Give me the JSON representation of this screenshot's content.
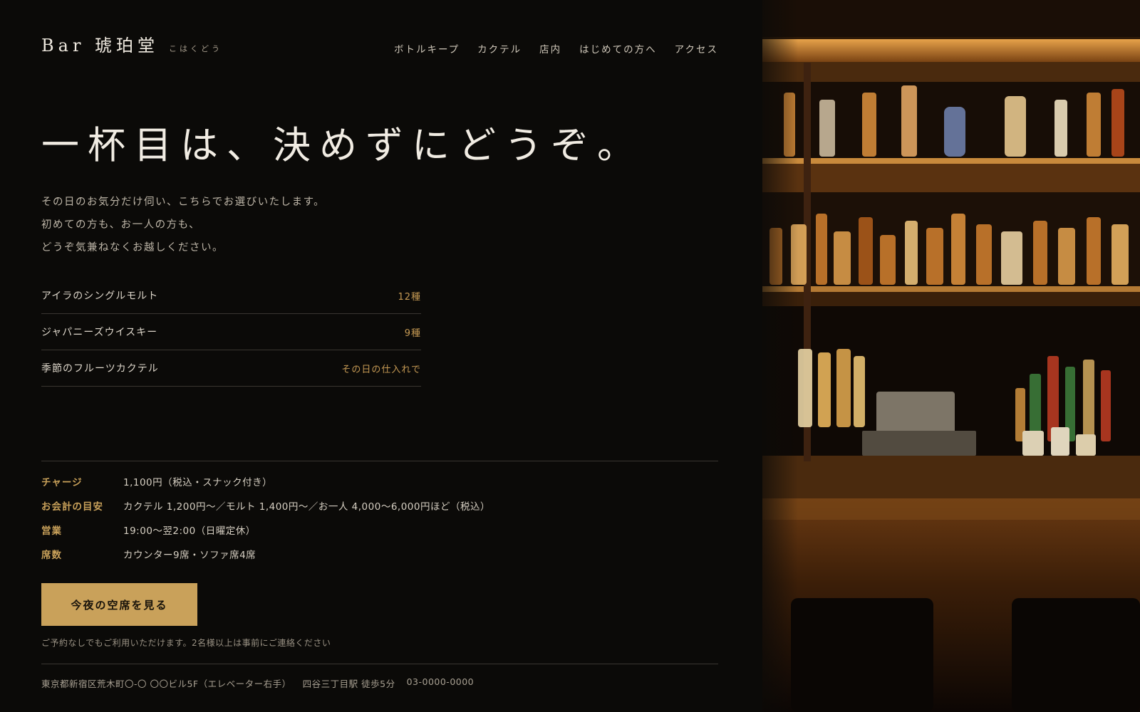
{
  "header": {
    "brand_name": "Bar 琥珀堂",
    "brand_kana": "こはくどう",
    "nav": [
      {
        "label": "ボトルキープ"
      },
      {
        "label": "カクテル"
      },
      {
        "label": "店内"
      },
      {
        "label": "はじめての方へ"
      },
      {
        "label": "アクセス"
      }
    ]
  },
  "hero": {
    "title": "一杯目は、決めずにどうぞ。",
    "lines": [
      "その日のお気分だけ伺い、こちらでお選びいたします。",
      "初めての方も、お一人の方も、",
      "どうぞ気兼ねなくお越しください。"
    ]
  },
  "features": [
    {
      "label": "アイラのシングルモルト",
      "value": "12種"
    },
    {
      "label": "ジャパニーズウイスキー",
      "value": "9種"
    },
    {
      "label": "季節のフルーツカクテル",
      "value": "その日の仕入れで"
    }
  ],
  "info": [
    {
      "key": "チャージ",
      "value": "1,100円（税込・スナック付き）"
    },
    {
      "key": "お会計の目安",
      "value": "カクテル 1,200円〜／モルト 1,400円〜／お一人 4,000〜6,000円ほど（税込）"
    },
    {
      "key": "営業",
      "value": "19:00〜翌2:00（日曜定休）"
    },
    {
      "key": "席数",
      "value": "カウンター9席・ソファ席4席"
    }
  ],
  "cta": {
    "label": "今夜の空席を見る",
    "note": "ご予約なしでもご利用いただけます。2名様以上は事前にご連絡ください"
  },
  "footer": {
    "address": "東京都新宿区荒木町〇-〇 〇〇ビル5F（エレベーター右手）",
    "station": "四谷三丁目駅 徒歩5分",
    "phone": "03-0000-0000"
  },
  "colors": {
    "background": "#0b0a08",
    "accent": "#c9a15a",
    "text": "#e9e4da"
  }
}
